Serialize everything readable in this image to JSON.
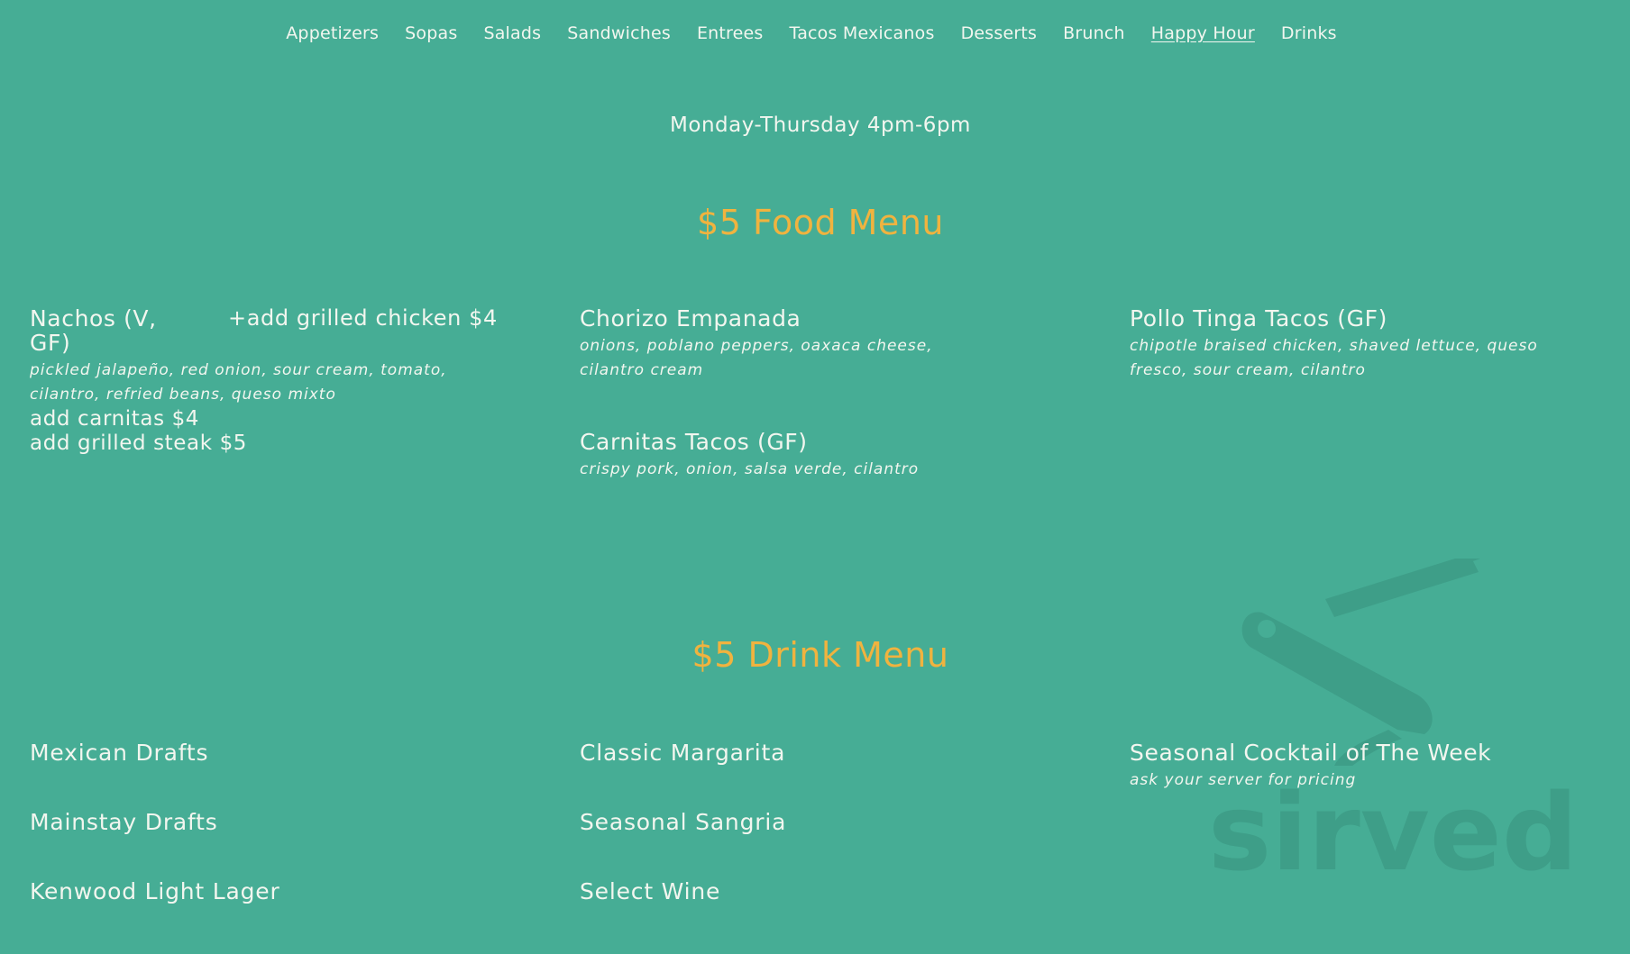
{
  "nav": {
    "items": [
      {
        "label": "Appetizers",
        "active": false
      },
      {
        "label": "Sopas",
        "active": false
      },
      {
        "label": "Salads",
        "active": false
      },
      {
        "label": "Sandwiches",
        "active": false
      },
      {
        "label": "Entrees",
        "active": false
      },
      {
        "label": "Tacos Mexicanos",
        "active": false
      },
      {
        "label": "Desserts",
        "active": false
      },
      {
        "label": "Brunch",
        "active": false
      },
      {
        "label": "Happy Hour",
        "active": true
      },
      {
        "label": "Drinks",
        "active": false
      }
    ]
  },
  "hours": "Monday-Thursday 4pm-6pm",
  "food_menu": {
    "title": "$5 Food Menu",
    "nachos": {
      "name": "Nachos (V, GF)",
      "addon_inline": "+add grilled chicken $4",
      "description": "pickled jalapeño, red onion, sour cream, tomato, cilantro, refried beans, queso mixto",
      "addons": [
        "add carnitas $4",
        "add grilled steak $5"
      ]
    },
    "chorizo": {
      "name": "Chorizo Empanada",
      "description": "onions, poblano peppers, oaxaca cheese, cilantro cream"
    },
    "carnitas": {
      "name": "Carnitas Tacos (GF)",
      "description": "crispy pork, onion, salsa verde, cilantro"
    },
    "pollo": {
      "name": "Pollo Tinga Tacos (GF)",
      "description": "chipotle braised chicken, shaved lettuce, queso fresco, sour cream, cilantro"
    }
  },
  "drink_menu": {
    "title": "$5 Drink Menu",
    "col1": [
      "Mexican Drafts",
      "Mainstay Drafts",
      "Kenwood Light Lager"
    ],
    "col2": [
      "Classic Margarita",
      "Seasonal Sangria",
      "Select Wine"
    ],
    "seasonal": {
      "name": "Seasonal Cocktail of The Week",
      "note": "ask your server for pricing"
    }
  },
  "watermark": {
    "text": "sirved",
    "icon": "knife-fork-icon"
  },
  "colors": {
    "background": "#46ad95",
    "text": "#f2f6ef",
    "accent": "#f0b33f"
  }
}
